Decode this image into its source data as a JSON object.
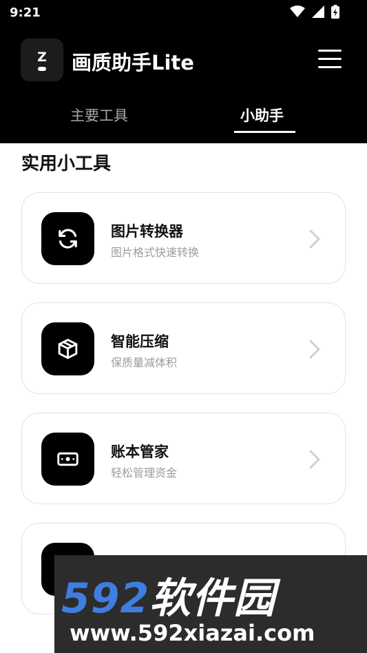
{
  "status_bar": {
    "time": "9:21"
  },
  "app": {
    "title": "画质助手Lite",
    "logo_letter": "Z"
  },
  "tabs": [
    {
      "label": "主要工具",
      "selected": false
    },
    {
      "label": "小助手",
      "selected": true
    }
  ],
  "section": {
    "title": "实用小工具"
  },
  "tools": [
    {
      "title": "图片转换器",
      "subtitle": "图片格式快速转换",
      "icon": "refresh-icon"
    },
    {
      "title": "智能压缩",
      "subtitle": "保质量减体积",
      "icon": "box-icon"
    },
    {
      "title": "账本管家",
      "subtitle": "轻松管理资金",
      "icon": "wallet-icon"
    },
    {
      "title": "",
      "subtitle": "",
      "icon": "unknown-icon"
    }
  ],
  "watermark": {
    "brand_number": "592",
    "brand_text": "软件园",
    "url": "www.592xiazai.com"
  },
  "colors": {
    "appbar": "#000000",
    "accent_blue": "#3f7de0",
    "card_border": "#e2e2e2"
  }
}
